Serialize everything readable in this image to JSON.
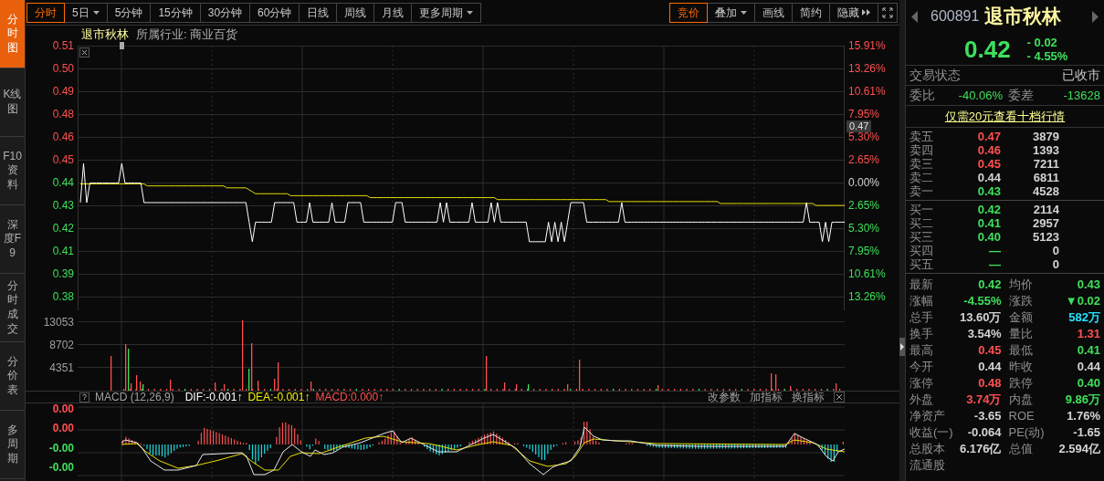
{
  "sidebar": {
    "tabs": [
      {
        "label": "分时图",
        "selected": true
      },
      {
        "label": "K线图",
        "selected": false
      },
      {
        "label": "F10资料",
        "selected": false
      },
      {
        "label": "深度F9",
        "selected": false
      },
      {
        "label": "分时成交",
        "selected": false
      },
      {
        "label": "分价表",
        "selected": false
      },
      {
        "label": "多周期",
        "selected": false
      }
    ]
  },
  "toolbar": {
    "periods": [
      {
        "label": "分时",
        "selected": true,
        "kind": "button"
      },
      {
        "label": "5日",
        "selected": false,
        "kind": "dropdown"
      },
      {
        "label": "5分钟",
        "selected": false,
        "kind": "button"
      },
      {
        "label": "15分钟",
        "selected": false,
        "kind": "button"
      },
      {
        "label": "30分钟",
        "selected": false,
        "kind": "button"
      },
      {
        "label": "60分钟",
        "selected": false,
        "kind": "button"
      },
      {
        "label": "日线",
        "selected": false,
        "kind": "button"
      },
      {
        "label": "周线",
        "selected": false,
        "kind": "button"
      },
      {
        "label": "月线",
        "selected": false,
        "kind": "button"
      },
      {
        "label": "更多周期",
        "selected": false,
        "kind": "dropdown"
      }
    ],
    "tools": [
      {
        "label": "竞价",
        "selected": true,
        "kind": "button"
      },
      {
        "label": "叠加",
        "selected": false,
        "kind": "dropdown"
      },
      {
        "label": "画线",
        "selected": false,
        "kind": "button"
      },
      {
        "label": "简约",
        "selected": false,
        "kind": "button"
      },
      {
        "label": "隐藏",
        "selected": false,
        "kind": "expand"
      }
    ]
  },
  "price_chart": {
    "stock_name": "退市秋林",
    "industry": "所属行业: 商业百货",
    "cursor_price": "0.47",
    "change_axis": [
      "15.91%",
      "13.26%",
      "10.61%",
      "7.95%",
      "5.30%",
      "2.65%",
      "0.00%",
      "2.65%",
      "5.30%",
      "7.95%",
      "10.61%",
      "13.26%"
    ],
    "chart_data": {
      "type": "line",
      "grid": true,
      "categories": [
        null,
        null,
        null,
        null,
        null,
        null,
        null,
        null,
        null,
        null,
        null,
        null,
        null,
        null,
        null,
        null,
        null,
        null,
        null,
        null,
        null,
        null,
        null,
        null,
        null,
        null,
        null,
        null,
        null,
        null,
        null,
        null,
        null,
        null,
        null,
        null,
        null,
        null,
        null,
        null,
        null,
        null,
        null,
        null,
        null,
        null,
        null,
        null,
        null,
        null,
        null,
        null,
        null,
        null,
        null,
        null,
        null,
        null,
        null,
        null,
        null,
        null,
        null,
        null,
        null,
        null,
        null,
        null,
        null,
        null,
        null,
        null,
        null,
        null,
        null,
        null,
        null,
        null,
        null,
        null,
        null,
        null,
        null,
        null,
        null,
        null,
        null,
        null,
        null,
        null,
        null,
        null,
        null,
        null,
        null,
        null,
        null,
        null,
        null,
        null,
        null,
        null,
        null,
        null,
        null,
        null,
        null,
        null,
        null,
        null,
        null,
        null,
        null,
        null,
        null,
        null,
        null,
        null,
        null,
        null,
        null,
        null,
        null,
        null,
        null,
        null,
        null,
        null,
        null,
        null,
        null,
        null,
        null,
        null,
        null,
        null,
        null,
        null,
        null,
        null,
        null,
        null,
        null,
        null,
        null,
        null,
        null,
        null,
        null,
        null,
        null,
        null,
        null,
        null,
        null,
        null,
        null,
        null,
        null,
        null,
        null,
        null,
        null,
        null,
        null,
        null,
        null,
        null,
        null,
        null,
        null,
        null,
        null,
        null,
        null,
        null,
        null,
        null,
        null,
        null,
        null,
        null,
        null,
        null,
        null,
        null,
        null,
        null,
        null,
        null,
        null,
        null,
        null,
        null,
        null,
        null,
        null,
        null,
        null,
        null,
        null,
        null,
        null,
        null,
        null,
        null,
        null,
        null,
        null,
        null,
        null,
        null,
        null,
        null,
        null,
        null,
        null,
        null,
        null,
        null,
        null,
        null,
        null,
        null,
        null,
        null,
        null,
        null,
        null,
        null,
        null,
        null,
        null,
        null,
        null,
        null,
        null,
        null,
        null,
        null,
        null
      ],
      "ylim": [
        0.3817,
        0.51
      ],
      "yticks": [
        {
          "value": 0.51,
          "label": "0.51"
        },
        {
          "value": 0.4983,
          "label": "0.50"
        },
        {
          "value": 0.4867,
          "label": "0.49"
        },
        {
          "value": 0.475,
          "label": "0.48"
        },
        {
          "value": 0.4633,
          "label": "0.46"
        },
        {
          "value": 0.4517,
          "label": "0.45"
        },
        {
          "value": 0.44,
          "label": "0.44"
        },
        {
          "value": 0.4283,
          "label": "0.43"
        },
        {
          "value": 0.4167,
          "label": "0.42"
        },
        {
          "value": 0.405,
          "label": "0.41"
        },
        {
          "value": 0.3933,
          "label": "0.39"
        },
        {
          "value": 0.3817,
          "label": "0.38"
        }
      ],
      "series": [
        {
          "color": "#ffffff",
          "values": [
            0.43,
            0.45,
            0.43,
            0.44,
            0.44,
            0.44,
            0.44,
            0.44,
            0.44,
            0.44,
            0.44,
            0.44,
            0.44,
            0.45,
            0.44,
            0.44,
            0.44,
            0.44,
            0.44,
            0.44,
            0.43,
            0.43,
            0.43,
            0.43,
            0.43,
            0.43,
            0.43,
            0.43,
            0.43,
            0.43,
            0.43,
            0.43,
            0.43,
            0.43,
            0.43,
            0.43,
            0.43,
            0.43,
            0.43,
            0.43,
            0.43,
            0.43,
            0.43,
            0.43,
            0.43,
            0.43,
            0.43,
            0.43,
            0.43,
            0.43,
            0.43,
            0.43,
            0.43,
            0.42,
            0.41,
            0.42,
            0.42,
            0.42,
            0.42,
            0.42,
            0.42,
            0.43,
            0.43,
            0.43,
            0.43,
            0.43,
            0.43,
            0.43,
            0.42,
            0.42,
            0.42,
            0.42,
            0.43,
            0.42,
            0.42,
            0.42,
            0.42,
            0.42,
            0.42,
            0.43,
            0.42,
            0.42,
            0.42,
            0.42,
            0.43,
            0.43,
            0.43,
            0.43,
            0.43,
            0.42,
            0.42,
            0.42,
            0.42,
            0.42,
            0.42,
            0.42,
            0.42,
            0.42,
            0.42,
            0.43,
            0.43,
            0.43,
            0.42,
            0.42,
            0.42,
            0.42,
            0.42,
            0.42,
            0.42,
            0.42,
            0.42,
            0.42,
            0.42,
            0.43,
            0.42,
            0.43,
            0.42,
            0.42,
            0.42,
            0.42,
            0.42,
            0.42,
            0.42,
            0.43,
            0.42,
            0.42,
            0.42,
            0.42,
            0.42,
            0.43,
            0.42,
            0.43,
            0.42,
            0.42,
            0.42,
            0.42,
            0.42,
            0.42,
            0.42,
            0.42,
            0.42,
            0.41,
            0.41,
            0.41,
            0.41,
            0.41,
            0.41,
            0.42,
            0.41,
            0.42,
            0.41,
            0.42,
            0.41,
            0.42,
            0.43,
            0.43,
            0.43,
            0.43,
            0.43,
            0.42,
            0.42,
            0.42,
            0.42,
            0.42,
            0.42,
            0.42,
            0.42,
            0.42,
            0.42,
            0.42,
            0.43,
            0.42,
            0.42,
            0.42,
            0.42,
            0.42,
            0.42,
            0.42,
            0.42,
            0.42,
            0.42,
            0.42,
            0.42,
            0.42,
            0.42,
            0.42,
            0.42,
            0.42,
            0.42,
            0.42,
            0.42,
            0.42,
            0.42,
            0.42,
            0.42,
            0.42,
            0.42,
            0.42,
            0.42,
            0.42,
            0.42,
            0.42,
            0.42,
            0.42,
            0.42,
            0.42,
            0.42,
            0.42,
            0.42,
            0.42,
            0.42,
            0.42,
            0.42,
            0.42,
            0.42,
            0.42,
            0.42,
            0.42,
            0.42,
            0.42,
            0.42,
            0.42,
            0.42,
            0.42,
            0.42,
            0.42,
            0.42,
            0.42,
            0.43,
            0.42,
            0.42,
            0.42,
            0.42,
            0.41,
            0.42,
            0.41,
            0.42,
            0.42,
            0.42,
            0.42,
            0.42
          ]
        },
        {
          "color": "#e8e000",
          "values": [
            0.44,
            0.44,
            0.44,
            0.44,
            0.44,
            0.44,
            0.44,
            0.44,
            0.44,
            0.44,
            0.44,
            0.44,
            0.44,
            0.44,
            0.44,
            0.44,
            0.44,
            0.44,
            0.44,
            0.44,
            0.44,
            0.439,
            0.439,
            0.439,
            0.439,
            0.439,
            0.439,
            0.439,
            0.439,
            0.439,
            0.439,
            0.439,
            0.439,
            0.439,
            0.439,
            0.439,
            0.439,
            0.439,
            0.439,
            0.439,
            0.439,
            0.439,
            0.439,
            0.439,
            0.439,
            0.439,
            0.438,
            0.438,
            0.438,
            0.438,
            0.438,
            0.438,
            0.438,
            0.437,
            0.436,
            0.435,
            0.435,
            0.435,
            0.435,
            0.435,
            0.435,
            0.435,
            0.435,
            0.435,
            0.435,
            0.435,
            0.434,
            0.434,
            0.434,
            0.434,
            0.434,
            0.434,
            0.434,
            0.434,
            0.434,
            0.434,
            0.434,
            0.434,
            0.434,
            0.434,
            0.434,
            0.434,
            0.434,
            0.434,
            0.434,
            0.434,
            0.434,
            0.434,
            0.434,
            0.434,
            0.434,
            0.433,
            0.433,
            0.433,
            0.433,
            0.433,
            0.433,
            0.433,
            0.433,
            0.433,
            0.433,
            0.433,
            0.433,
            0.433,
            0.433,
            0.433,
            0.433,
            0.433,
            0.433,
            0.433,
            0.433,
            0.433,
            0.433,
            0.433,
            0.433,
            0.433,
            0.433,
            0.433,
            0.433,
            0.433,
            0.433,
            0.433,
            0.433,
            0.433,
            0.433,
            0.433,
            0.433,
            0.433,
            0.433,
            0.433,
            0.433,
            0.432,
            0.432,
            0.432,
            0.432,
            0.432,
            0.432,
            0.432,
            0.432,
            0.432,
            0.432,
            0.432,
            0.432,
            0.432,
            0.432,
            0.432,
            0.432,
            0.432,
            0.432,
            0.432,
            0.432,
            0.432,
            0.432,
            0.432,
            0.432,
            0.432,
            0.432,
            0.432,
            0.432,
            0.432,
            0.432,
            0.432,
            0.432,
            0.432,
            0.432,
            0.432,
            0.431,
            0.431,
            0.431,
            0.431,
            0.431,
            0.431,
            0.431,
            0.431,
            0.431,
            0.431,
            0.431,
            0.431,
            0.431,
            0.431,
            0.431,
            0.431,
            0.431,
            0.431,
            0.431,
            0.431,
            0.431,
            0.431,
            0.431,
            0.431,
            0.431,
            0.431,
            0.431,
            0.431,
            0.431,
            0.431,
            0.431,
            0.431,
            0.431,
            0.431,
            0.431,
            0.43,
            0.43,
            0.43,
            0.43,
            0.43,
            0.43,
            0.43,
            0.43,
            0.43,
            0.43,
            0.43,
            0.43,
            0.43,
            0.43,
            0.43,
            0.43,
            0.43,
            0.43,
            0.43,
            0.43,
            0.43,
            0.43,
            0.43,
            0.43,
            0.43,
            0.43,
            0.43,
            0.43,
            0.43,
            0.43,
            0.429,
            0.429,
            0.429,
            0.429,
            0.429,
            0.429,
            0.429,
            0.429,
            0.429,
            0.429
          ]
        }
      ]
    }
  },
  "volume_chart": {
    "axis": [
      "13053",
      "8702",
      "4351"
    ]
  },
  "macd": {
    "help": "?",
    "indicator": "MACD (12,26,9)",
    "dif": "DIF:-0.001↑",
    "dea": "DEA:-0.001↑",
    "value": "MACD:0.000↑",
    "actions": [
      "改参数",
      "加指标",
      "换指标"
    ],
    "axis": [
      {
        "label": "0.00",
        "color": "#ff5050"
      },
      {
        "label": "0.00",
        "color": "#ff5050"
      },
      {
        "label": "-0.00",
        "color": "#3ee05c"
      },
      {
        "label": "-0.00",
        "color": "#3ee05c"
      }
    ]
  },
  "quote": {
    "code": "600891",
    "name": "退市秋林",
    "price": "0.42",
    "change": "- 0.02",
    "change_pct": "- 4.55%",
    "color": "#3ee05c"
  },
  "status": {
    "label": "交易状态",
    "value": "已收市"
  },
  "order_ratio": {
    "label": "委比",
    "value": "-40.06%",
    "diff_label": "委差",
    "diff_value": "-13628"
  },
  "promo_link": "仅需20元查看十档行情",
  "asks": [
    {
      "label": "卖五",
      "price": "0.47",
      "volume": "3879",
      "color": "#ff5050"
    },
    {
      "label": "卖四",
      "price": "0.46",
      "volume": "1393",
      "color": "#ff5050"
    },
    {
      "label": "卖三",
      "price": "0.45",
      "volume": "7211",
      "color": "#ff5050"
    },
    {
      "label": "卖二",
      "price": "0.44",
      "volume": "6811",
      "color": "#d4d4d4"
    },
    {
      "label": "卖一",
      "price": "0.43",
      "volume": "4528",
      "color": "#3ee05c"
    }
  ],
  "bids": [
    {
      "label": "买一",
      "price": "0.42",
      "volume": "2114",
      "color": "#3ee05c"
    },
    {
      "label": "买二",
      "price": "0.41",
      "volume": "2957",
      "color": "#3ee05c"
    },
    {
      "label": "买三",
      "price": "0.40",
      "volume": "5123",
      "color": "#3ee05c"
    },
    {
      "label": "买四",
      "price": "—",
      "volume": "0",
      "color": "#3ee05c"
    },
    {
      "label": "买五",
      "price": "—",
      "volume": "0",
      "color": "#3ee05c"
    }
  ],
  "stats": [
    {
      "label": "最新",
      "value": "0.42",
      "color": "#3ee05c"
    },
    {
      "label": "均价",
      "value": "0.43",
      "color": "#3ee05c"
    },
    {
      "label": "涨幅",
      "value": "-4.55%",
      "color": "#3ee05c"
    },
    {
      "label": "涨跌",
      "value": "▼0.02",
      "color": "#3ee05c"
    },
    {
      "label": "总手",
      "value": "13.60万",
      "color": "#d4d4d4"
    },
    {
      "label": "金额",
      "value": "582万",
      "color": "#22e4ff"
    },
    {
      "label": "换手",
      "value": "3.54%",
      "color": "#d4d4d4"
    },
    {
      "label": "量比",
      "value": "1.31",
      "color": "#ff5050"
    },
    {
      "label": "最高",
      "value": "0.45",
      "color": "#ff5050"
    },
    {
      "label": "最低",
      "value": "0.41",
      "color": "#3ee05c"
    },
    {
      "label": "今开",
      "value": "0.44",
      "color": "#d4d4d4"
    },
    {
      "label": "昨收",
      "value": "0.44",
      "color": "#d4d4d4"
    },
    {
      "label": "涨停",
      "value": "0.48",
      "color": "#ff5050"
    },
    {
      "label": "跌停",
      "value": "0.40",
      "color": "#3ee05c"
    },
    {
      "label": "外盘",
      "value": "3.74万",
      "color": "#ff5050"
    },
    {
      "label": "内盘",
      "value": "9.86万",
      "color": "#3ee05c"
    },
    {
      "label": "净资产",
      "value": "-3.65",
      "color": "#d4d4d4"
    },
    {
      "label": "ROE",
      "value": "1.76%",
      "color": "#d4d4d4"
    },
    {
      "label": "收益(一)",
      "value": "-0.064",
      "color": "#d4d4d4"
    },
    {
      "label": "PE(动)",
      "value": "-1.65",
      "color": "#d4d4d4"
    },
    {
      "label": "总股本",
      "value": "6.176亿",
      "color": "#d4d4d4"
    },
    {
      "label": "总值",
      "value": "2.594亿",
      "color": "#d4d4d4"
    },
    {
      "label": "流通股"
    }
  ]
}
